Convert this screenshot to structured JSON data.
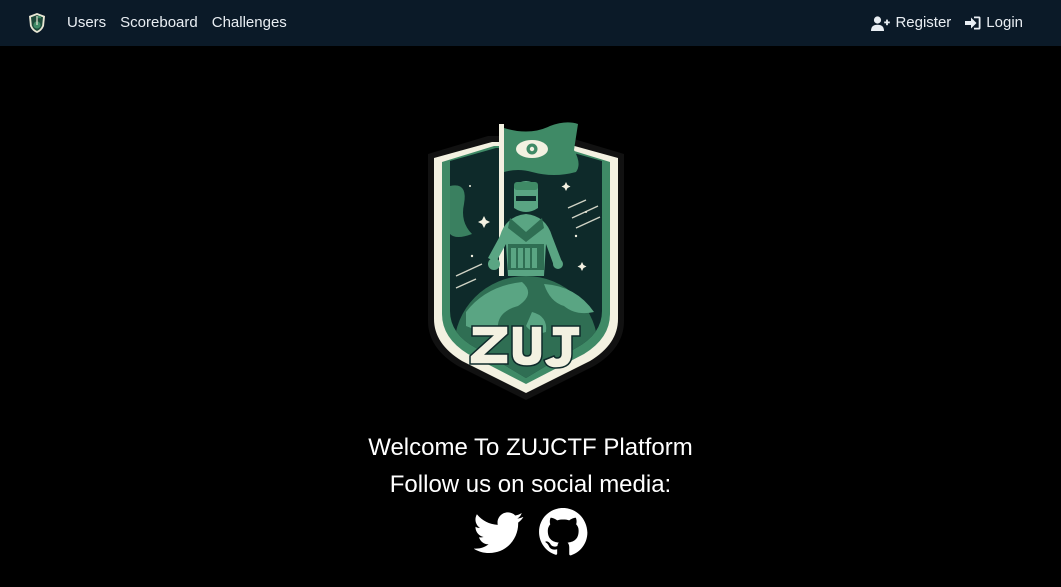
{
  "navbar": {
    "logo_icon": "zujctf-shield-icon",
    "links": [
      {
        "label": "Users"
      },
      {
        "label": "Scoreboard"
      },
      {
        "label": "Challenges"
      }
    ],
    "register": {
      "label": "Register",
      "icon": "user-plus-icon"
    },
    "login": {
      "label": "Login",
      "icon": "sign-in-icon"
    },
    "background": "#0b1a28"
  },
  "hero": {
    "emblem_icon": "zujctf-emblem",
    "welcome_text": "Welcome To ZUJCTF Platform",
    "follow_text": "Follow us on social media:"
  },
  "social": [
    {
      "icon": "twitter-icon"
    },
    {
      "icon": "github-icon"
    }
  ],
  "colors": {
    "page_background": "#000000",
    "emblem_green": "#3f8a66",
    "emblem_cream": "#f3f1e1",
    "emblem_dark": "#0e2a2a"
  }
}
